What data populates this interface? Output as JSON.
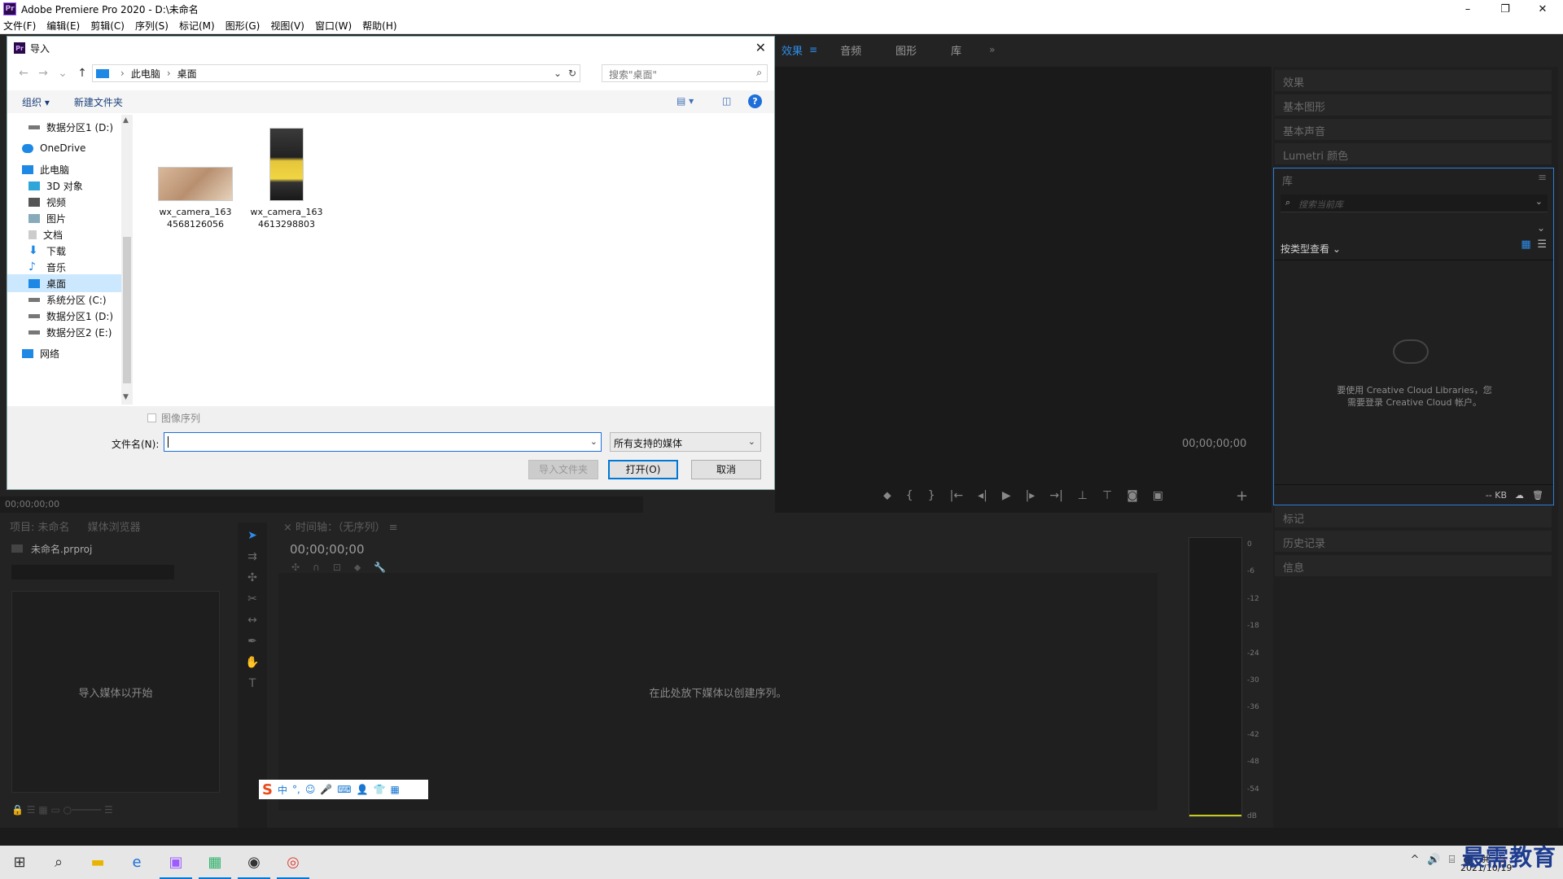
{
  "app": {
    "title": "Adobe Premiere Pro 2020 - D:\\未命名",
    "logo": "Pr",
    "window_controls": [
      "–",
      "❐",
      "✕"
    ]
  },
  "menu": [
    "文件(F)",
    "编辑(E)",
    "剪辑(C)",
    "序列(S)",
    "标记(M)",
    "图形(G)",
    "视图(V)",
    "窗口(W)",
    "帮助(H)"
  ],
  "workspace_tabs": {
    "active": "效果",
    "items": [
      "音频",
      "图形",
      "库"
    ],
    "menu_icon": "≡",
    "more_icon": "»"
  },
  "program": {
    "timecode": "00;00;00;00",
    "source_timecode": "00;00;00;00"
  },
  "right_panels": {
    "effects": "效果",
    "essential_graphics": "基本图形",
    "essential_sound": "基本声音",
    "lumetri": "Lumetri 颜色",
    "markers": "标记",
    "history": "历史记录",
    "info": "信息"
  },
  "library": {
    "title": "库",
    "search_placeholder": "搜索当前库",
    "view_label": "按类型查看",
    "cc_message_line1": "要使用 Creative Cloud Libraries，您",
    "cc_message_line2": "需要登录 Creative Cloud 帐户。",
    "size": "-- KB"
  },
  "project": {
    "tab_project": "项目: 未命名",
    "tab_media": "媒体浏览器",
    "file": "未命名.prproj",
    "empty_text": "导入媒体以开始"
  },
  "timeline": {
    "title": "时间轴：（无序列）",
    "timecode": "00;00;00;00",
    "drop_text": "在此处放下媒体以创建序列。"
  },
  "meter": {
    "scale": [
      "0",
      "-6",
      "-12",
      "-18",
      "-24",
      "-30",
      "-36",
      "-42",
      "-48",
      "-54",
      "dB"
    ]
  },
  "ime": {
    "lang": "中"
  },
  "dialog": {
    "title": "导入",
    "path": [
      "此电脑",
      "桌面"
    ],
    "search_placeholder": "搜索\"桌面\"",
    "organize": "组织 ▾",
    "new_folder": "新建文件夹",
    "nav_items": [
      {
        "label": "数据分区1 (D:)",
        "icon": "drive-icon"
      },
      {
        "label": "OneDrive",
        "icon": "cloud-icon"
      },
      {
        "label": "此电脑",
        "icon": "computer-icon"
      },
      {
        "label": "3D 对象",
        "icon": "cube-icon"
      },
      {
        "label": "视频",
        "icon": "video-icon"
      },
      {
        "label": "图片",
        "icon": "picture-icon"
      },
      {
        "label": "文档",
        "icon": "document-icon"
      },
      {
        "label": "下载",
        "icon": "download-icon"
      },
      {
        "label": "音乐",
        "icon": "music-icon"
      },
      {
        "label": "桌面",
        "icon": "desktop-icon"
      },
      {
        "label": "系统分区 (C:)",
        "icon": "drive-icon"
      },
      {
        "label": "数据分区1 (D:)",
        "icon": "drive-icon"
      },
      {
        "label": "数据分区2 (E:)",
        "icon": "drive-icon"
      },
      {
        "label": "网络",
        "icon": "network-icon"
      }
    ],
    "files": [
      {
        "line1": "wx_camera_163",
        "line2": "4568126056"
      },
      {
        "line1": "wx_camera_163",
        "line2": "4613298803"
      }
    ],
    "image_sequence": "图像序列",
    "filename_label": "文件名(N):",
    "filename_value": "",
    "filetype": "所有支持的媒体",
    "btn_import_folder": "导入文件夹",
    "btn_open": "打开(O)",
    "btn_cancel": "取消"
  },
  "taskbar": {
    "date": "2021/10/19",
    "watermark": "最需教育"
  }
}
